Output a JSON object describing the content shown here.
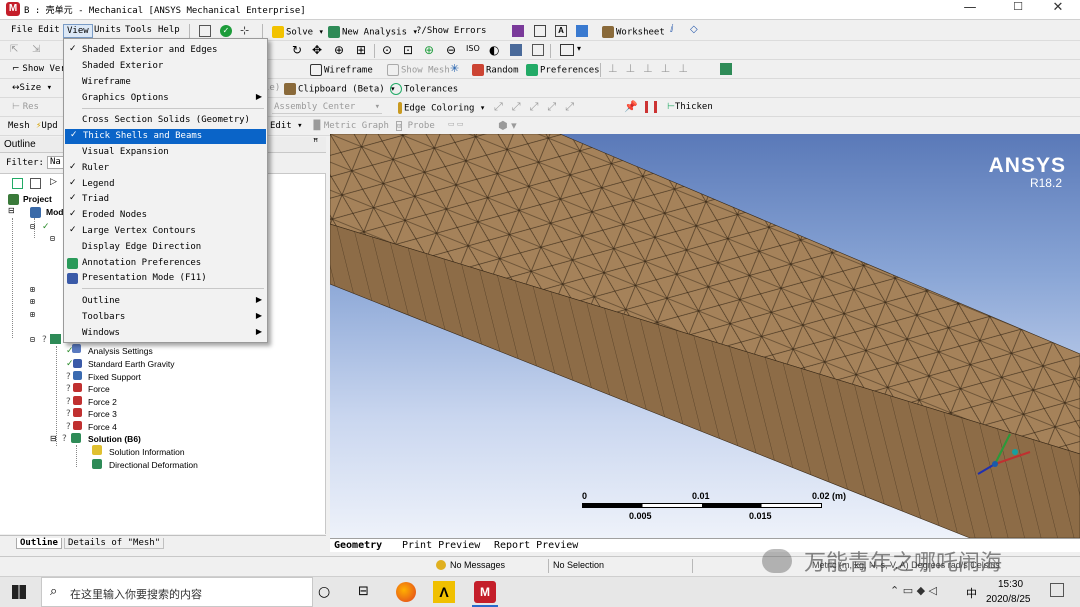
{
  "window": {
    "app_logo": "M",
    "title": "B : 壳单元 - Mechanical [ANSYS Mechanical Enterprise]",
    "minimize": "—",
    "maximize": "☐",
    "close": "✕"
  },
  "menubar": {
    "items": [
      "File",
      "Edit",
      "View",
      "Units",
      "Tools",
      "Help"
    ],
    "solve": "Solve",
    "new_analysis": "New Analysis",
    "show_errors": "?/Show Errors",
    "worksheet": "Worksheet"
  },
  "toolbar2": {
    "show_vertices": "Show Ver",
    "wireframe": "Wireframe",
    "show_mesh": "Show Mesh",
    "random": "Random",
    "preferences": "Preferences"
  },
  "toolbar3": {
    "size": "Size",
    "clipboard": "Clipboard (Beta)",
    "tolerances": "Tolerances",
    "style_suffix": "le)"
  },
  "toolbar4": {
    "reset": "Res",
    "assembly_center": "Assembly Center",
    "edge_coloring": "Edge Coloring",
    "thicken": "Thicken"
  },
  "toolbar5": {
    "mesh": "Mesh",
    "update": "Upd",
    "edit": "Edit",
    "metric_graph": "Metric Graph",
    "probe": "Probe"
  },
  "outline": {
    "title": "Outline",
    "pin": "ꟸ",
    "filter_label": "Filter:",
    "filter_value": "Na",
    "tree": {
      "project": "Project",
      "model": "Mod",
      "analysis_settings": "Analysis Settings",
      "gravity": "Standard Earth Gravity",
      "fixed_support": "Fixed Support",
      "force": "Force",
      "force2": "Force 2",
      "force3": "Force 3",
      "force4": "Force 4",
      "solution": "Solution (B6)",
      "solution_info": "Solution Information",
      "directional_deformation": "Directional Deformation"
    }
  },
  "bottom_tabs": [
    "Outline",
    "Details of \"Mesh\""
  ],
  "view_menu": {
    "items": [
      {
        "label": "Shaded Exterior and Edges",
        "checked": true,
        "submenu": false
      },
      {
        "label": "Shaded Exterior",
        "checked": false,
        "submenu": false
      },
      {
        "label": "Wireframe",
        "checked": false,
        "submenu": false
      },
      {
        "label": "Graphics Options",
        "checked": false,
        "submenu": true
      },
      {
        "label": "Cross Section Solids (Geometry)",
        "checked": false,
        "submenu": false
      },
      {
        "label": "Thick Shells and Beams",
        "checked": true,
        "submenu": false,
        "highlighted": true
      },
      {
        "label": "Visual Expansion",
        "checked": false,
        "submenu": false
      },
      {
        "label": "Ruler",
        "checked": true,
        "submenu": false
      },
      {
        "label": "Legend",
        "checked": true,
        "submenu": false
      },
      {
        "label": "Triad",
        "checked": true,
        "submenu": false
      },
      {
        "label": "Eroded Nodes",
        "checked": true,
        "submenu": false
      },
      {
        "label": "Large Vertex Contours",
        "checked": true,
        "submenu": false
      },
      {
        "label": "Display Edge Direction",
        "checked": false,
        "submenu": false
      },
      {
        "label": "Annotation Preferences",
        "checked": false,
        "submenu": false,
        "icon": "annotation-icon"
      },
      {
        "label": "Presentation Mode (F11)",
        "checked": false,
        "submenu": false,
        "icon": "presentation-icon"
      },
      {
        "label": "Outline",
        "checked": false,
        "submenu": true
      },
      {
        "label": "Toolbars",
        "checked": false,
        "submenu": true
      },
      {
        "label": "Windows",
        "checked": false,
        "submenu": true
      }
    ]
  },
  "viewport": {
    "brand": "ANSYS",
    "version": "R18.2",
    "scale": {
      "labels_top": [
        "0",
        "0.01",
        "0.02 (m)"
      ],
      "labels_bottom": [
        "0.005",
        "0.015"
      ]
    },
    "tabs": [
      "Geometry",
      "Print Preview",
      "Report Preview"
    ]
  },
  "statusbar": {
    "messages": "No Messages",
    "selection": "No Selection",
    "units_partial": "Metric (m, kg, N, s, V, A)  Degrees  rad/s  Celsius",
    "watermark": "万能青年之哪吒闹海"
  },
  "taskbar": {
    "search_placeholder": "在这里输入你要搜索的内容",
    "ime": "中",
    "time": "15:30",
    "date": "2020/8/25"
  },
  "colors": {
    "body_fill": "#a5825a",
    "mesh_line": "#3a2a18",
    "highlight": "#0a64c8",
    "ansys_brand": "#ffffff"
  }
}
